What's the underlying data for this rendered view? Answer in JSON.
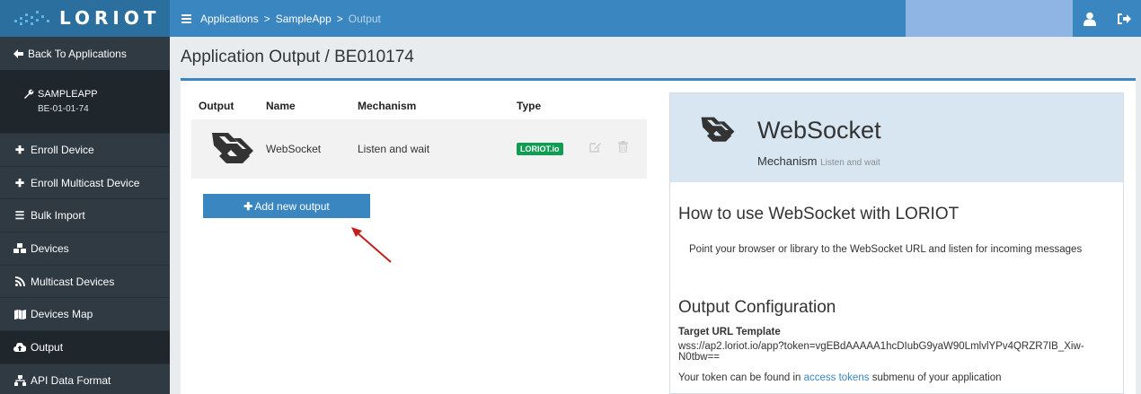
{
  "brand": {
    "logo_text": "LORIOT"
  },
  "breadcrumb": [
    "Applications",
    "SampleApp",
    "Output"
  ],
  "breadcrumb_sep": ">",
  "sidebar": {
    "back_label": "Back To Applications",
    "app_name": "SAMPLEAPP",
    "app_eui": "BE-01-01-74",
    "items": [
      {
        "label": "Enroll Device",
        "icon": "plus-icon"
      },
      {
        "label": "Enroll Multicast Device",
        "icon": "plus-icon"
      },
      {
        "label": "Bulk Import",
        "icon": "list-icon"
      },
      {
        "label": "Devices",
        "icon": "cubes-icon"
      },
      {
        "label": "Multicast Devices",
        "icon": "rss-icon"
      },
      {
        "label": "Devices Map",
        "icon": "map-icon"
      },
      {
        "label": "Output",
        "icon": "cloud-upload-icon",
        "active": true
      },
      {
        "label": "API Data Format",
        "icon": "sitemap-icon"
      }
    ]
  },
  "page": {
    "title": "Application Output / BE010174"
  },
  "table": {
    "headers": [
      "Output",
      "Name",
      "Mechanism",
      "Type"
    ],
    "rows": [
      {
        "name": "WebSocket",
        "mechanism": "Listen and wait",
        "type_badge": "LORIOT.io"
      }
    ]
  },
  "add_button": {
    "label": "Add new output"
  },
  "detail": {
    "title": "WebSocket",
    "mechanism_label": "Mechanism",
    "mechanism_value": "Listen and wait",
    "howto_heading": "How to use WebSocket with LORIOT",
    "howto_text": "Point your browser or library to the WebSocket URL and listen for incoming messages",
    "config_heading": "Output Configuration",
    "target_label": "Target URL Template",
    "target_value": "wss://ap2.loriot.io/app?token=vgEBdAAAAA1hcDIubG9yaW90LmlvlYPv4QRZR7IB_Xiw-N0tbw==",
    "token_prefix": "Your token can be found in",
    "token_link": "access tokens",
    "token_suffix": "submenu of your application"
  },
  "colors": {
    "primary": "#3a86c0",
    "sidebar": "#2f3a43",
    "badge": "#0e9e52",
    "arrow": "#c0201e"
  }
}
